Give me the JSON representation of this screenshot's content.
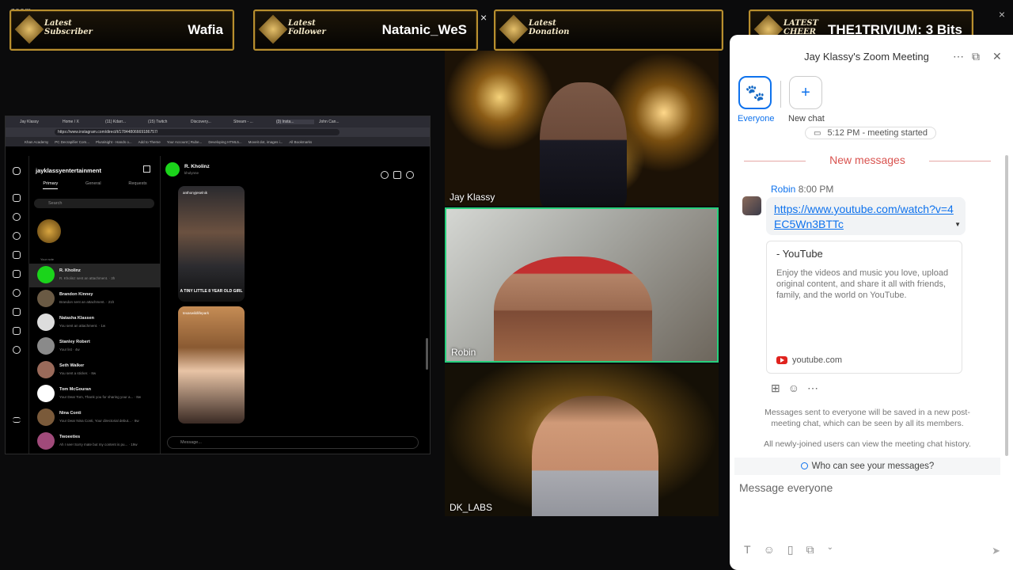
{
  "overlay": {
    "zoom_mark": "zoom",
    "banners": [
      {
        "label": "Latest\nSubscriber",
        "value": "Wafia"
      },
      {
        "label": "Latest\nFollower",
        "value": "Natanic_WeS"
      },
      {
        "label": "Latest\nDonation",
        "value": ""
      },
      {
        "label": "LATEST\nCHEER",
        "value": "THE1TRIVIUM: 3 Bits"
      }
    ],
    "close_glyph": "×"
  },
  "browser": {
    "tabs": [
      "Jay Klassy",
      "Home / X",
      "(11) Kdarr...",
      "(15) Twitch",
      "Discovery...",
      "Stream - ...",
      "(3) Insta...",
      "John Can..."
    ],
    "url": "https://www.instagram.com/direct/t/17844806669186757/",
    "bookmarks": [
      "Khan Academy",
      "PC Decrapifier Com...",
      "Pluralsight - Hands o...",
      "Add to Theme",
      "Your Account | Rube...",
      "Developing HTML5...",
      "Moveit dot, images i...",
      "All Bookmarks"
    ]
  },
  "instagram": {
    "username": "jayklassyentertainment",
    "filters": [
      "Primary",
      "General",
      "Requests"
    ],
    "search_placeholder": "Search",
    "note_label": "Your note",
    "conversations": [
      {
        "name": "R. Kholinz",
        "preview": "R. Kholinz sent an attachment. · 3h"
      },
      {
        "name": "Brandon Kinney",
        "preview": "Brandon sent an attachment. · 21h"
      },
      {
        "name": "Natasha Klassen",
        "preview": "You sent an attachment. · 1w"
      },
      {
        "name": "Stanley Robert",
        "preview": "Your list · 4w"
      },
      {
        "name": "Seth Walker",
        "preview": "You sent a sticker. · 8w"
      },
      {
        "name": "Tom McGouran",
        "preview": "Your Dear Tom, Thank you for sharing your a... · 8w"
      },
      {
        "name": "Nina Conti",
        "preview": "Your Dear Nina Conti, Your directorial debut... · 8w"
      },
      {
        "name": "Twoeeties",
        "preview": "Ah I see! Sorry mate but my content is pu... · 19w"
      }
    ],
    "chat_name": "R. Kholinz",
    "chat_sub": "kholynne",
    "reels": [
      {
        "handle": "anthonyjeselnik",
        "caption": "A TINY LITTLE 8 YEAR OLD GIRL"
      },
      {
        "handle": "texaswildlifepark",
        "caption": ""
      }
    ],
    "message_placeholder": "Message..."
  },
  "participants": [
    {
      "name": "Jay Klassy"
    },
    {
      "name": "Robin"
    },
    {
      "name": "DK_LABS"
    }
  ],
  "chat_panel": {
    "title": "Jay Klassy's Zoom Meeting",
    "tabs": [
      {
        "label": "Everyone",
        "icon": "paw-icon"
      },
      {
        "label": "New chat",
        "icon": "plus-icon"
      }
    ],
    "meeting_started": "5:12 PM - meeting started",
    "new_messages": "New messages",
    "message": {
      "sender": "Robin",
      "time": "8:00 PM",
      "link": "https://www.youtube.com/watch?v=4EC5Wn3BTTc",
      "preview_title": "- YouTube",
      "preview_desc": "Enjoy the videos and music you love, upload original content, and share it all with friends, family, and the world on YouTube.",
      "preview_domain": "youtube.com"
    },
    "notice": "Messages sent to everyone will be saved in a new post-meeting chat, which can be seen by all its members.",
    "notice2": "All newly-joined users can view the meeting chat history.",
    "who_can_see": "Who can see your messages?",
    "compose_placeholder": "Message everyone"
  },
  "colors": {
    "zoom_blue": "#0e72ed",
    "speaker_border": "#26d07c",
    "new_messages_red": "#d9534f"
  }
}
